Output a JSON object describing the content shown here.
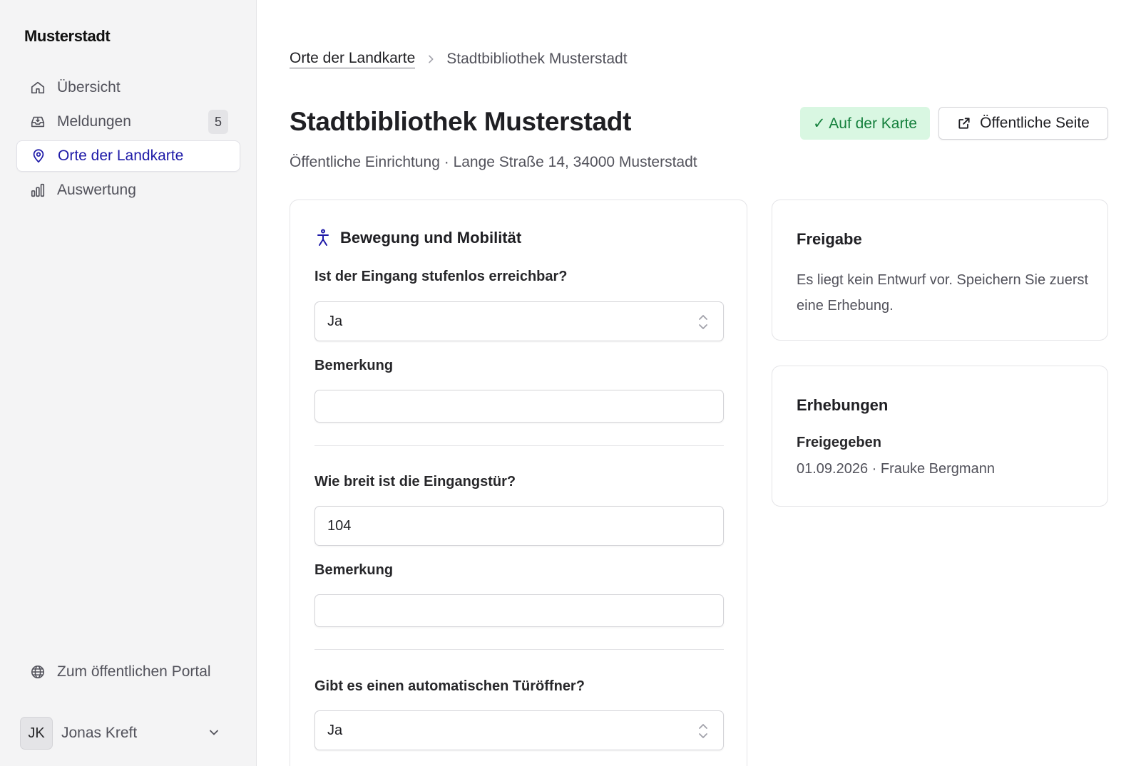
{
  "sidebar": {
    "brand": "Musterstadt",
    "items": [
      {
        "label": "Übersicht",
        "icon": "home-icon"
      },
      {
        "label": "Meldungen",
        "icon": "inbox-icon",
        "badge": "5"
      },
      {
        "label": "Orte der Landkarte",
        "icon": "map-pin-icon",
        "active": true
      },
      {
        "label": "Auswertung",
        "icon": "bar-chart-icon"
      }
    ],
    "portal_link": "Zum öffentlichen Portal",
    "user": {
      "initials": "JK",
      "name": "Jonas Kreft"
    }
  },
  "breadcrumb": {
    "parent": "Orte der Landkarte",
    "current": "Stadtbibliothek Musterstadt"
  },
  "header": {
    "title": "Stadtbibliothek Musterstadt",
    "subtitle": "Öffentliche Einrichtung · Lange Straße 14, 34000 Musterstadt",
    "map_status": "✓ Auf der Karte",
    "public_page_button": "Öffentliche Seite"
  },
  "form": {
    "section_title": "Bewegung und Mobilität",
    "questions": [
      {
        "label": "Ist der Eingang stufenlos erreichbar?",
        "value": "Ja",
        "remark_label": "Bemerkung",
        "remark_value": ""
      },
      {
        "label": "Wie breit ist die Eingangstür?",
        "value": "104",
        "remark_label": "Bemerkung",
        "remark_value": ""
      },
      {
        "label": "Gibt es einen automatischen Türöffner?",
        "value": "Ja"
      }
    ]
  },
  "release": {
    "title": "Freigabe",
    "text": "Es liegt kein Entwurf vor. Speichern Sie zuerst eine Erhebung."
  },
  "surveys": {
    "title": "Erhebungen",
    "status": "Freigegeben",
    "meta": "01.09.2026 · Frauke Bergmann"
  },
  "colors": {
    "accent": "#1e1aa8",
    "success_bg": "#d9f7e2",
    "success_text": "#15803d",
    "sidebar_bg": "#f4f4f5"
  }
}
